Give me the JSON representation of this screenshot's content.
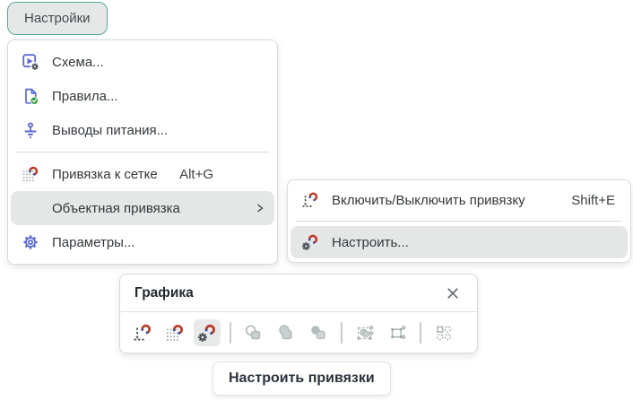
{
  "settings_button": {
    "label": "Настройки"
  },
  "settings_menu": {
    "items": [
      {
        "label": "Схема...",
        "icon": "schema-icon"
      },
      {
        "label": "Правила...",
        "icon": "rules-check-icon"
      },
      {
        "label": "Выводы питания...",
        "icon": "power-pin-ground-icon"
      },
      {
        "label": "Привязка к сетке",
        "shortcut": "Alt+G",
        "icon": "grid-snap-magnet-icon"
      },
      {
        "label": "Объектная привязка",
        "has_submenu": true,
        "state": "highlighted"
      },
      {
        "label": "Параметры...",
        "icon": "gear-outline-icon"
      }
    ]
  },
  "object_snap_submenu": {
    "items": [
      {
        "label": "Включить/Выключить привязку",
        "shortcut": "Shift+E",
        "icon": "snap-toggle-magnet-icon"
      },
      {
        "label": "Настроить...",
        "icon": "snap-configure-magnet-icon",
        "state": "highlighted"
      }
    ]
  },
  "graphics_panel": {
    "title": "Графика",
    "tools": [
      {
        "name": "snap-toggle",
        "state": "normal"
      },
      {
        "name": "grid-snap",
        "state": "normal"
      },
      {
        "name": "snap-configure",
        "state": "active"
      },
      {
        "name": "shape-exclude",
        "state": "disabled"
      },
      {
        "name": "shape-union",
        "state": "disabled"
      },
      {
        "name": "shape-intersect",
        "state": "disabled"
      },
      {
        "name": "select-group",
        "state": "disabled"
      },
      {
        "name": "edit-nodes",
        "state": "disabled"
      },
      {
        "name": "align-objects",
        "state": "disabled"
      }
    ]
  },
  "tooltip": {
    "text": "Настроить привязки"
  },
  "colors": {
    "accent_teal": "#55a89d",
    "icon_blue": "#5b68da",
    "magnet_red": "#bf3927",
    "magnet_blue": "#2c3f92",
    "check_green": "#2f9e44",
    "row_highlight": "#e5e6e6",
    "disabled_icon": "#aeb7b7"
  }
}
